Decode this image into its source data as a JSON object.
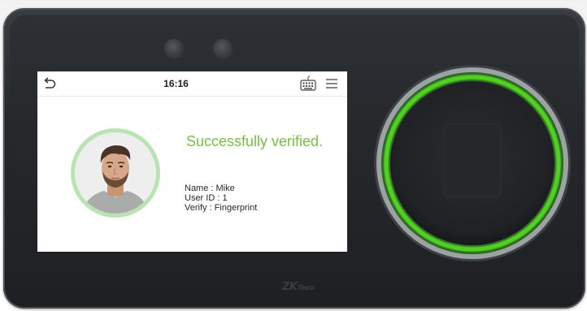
{
  "device": {
    "brand": "ZKTeco",
    "accent_color": "#76c043"
  },
  "status_bar": {
    "back_icon": "back-arrow-icon",
    "time": "16:16",
    "keyboard_icon": "keyboard-icon",
    "menu_icon": "menu-icon"
  },
  "result": {
    "message": "Successfully verified.",
    "name_line": "Name : Mike",
    "user_id_line": "User ID : 1",
    "verify_line": "Verify : Fingerprint"
  },
  "colors": {
    "success_green": "#76c043",
    "ring_green": "#4fd11e"
  }
}
